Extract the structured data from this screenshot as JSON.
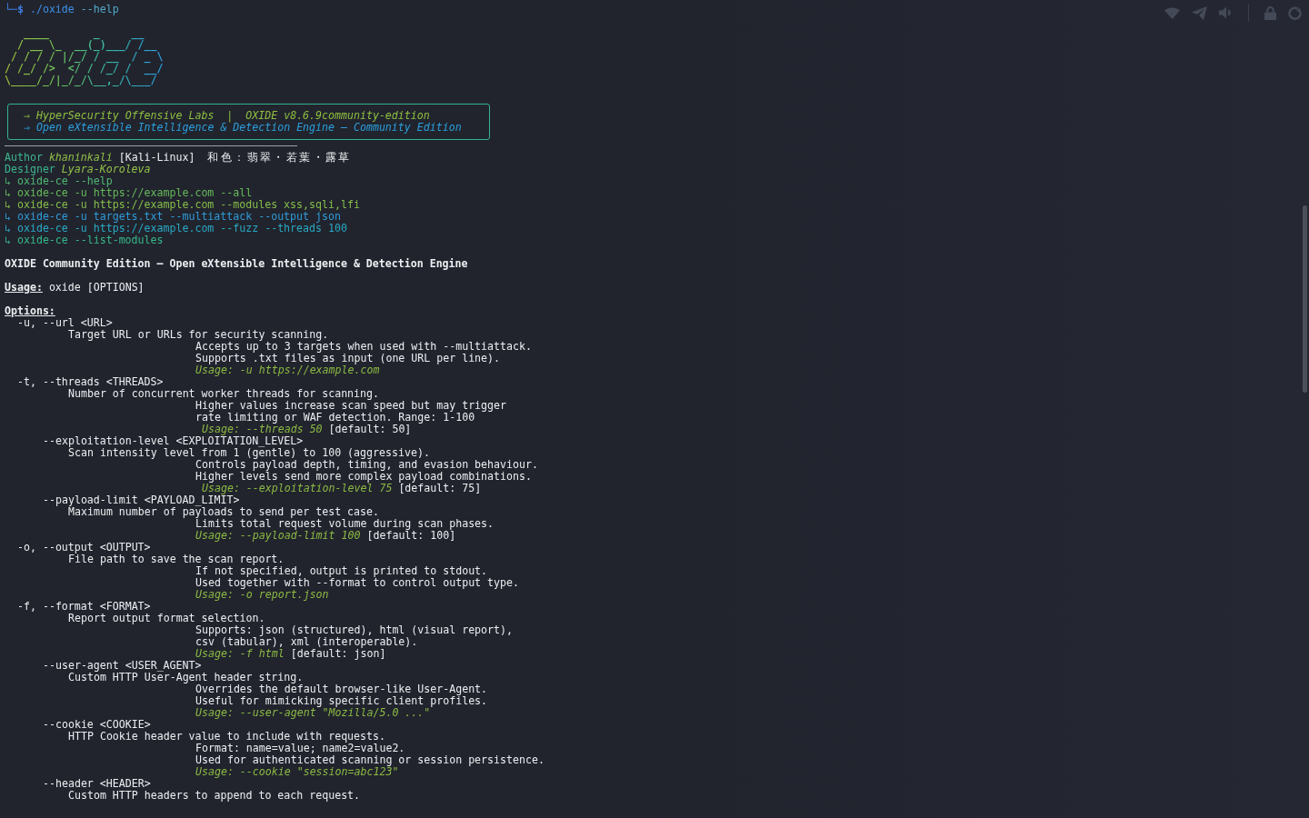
{
  "prompt": {
    "symbol": "└─$",
    "command": "./oxide",
    "args": "--help"
  },
  "logo": {
    "lines": [
      "   ____       _     __",
      "  / __ \\_  __(_)___/ /__",
      " / / / / |/_/ / __  / _ \\",
      "/ /_/ />  </ / /_/ /  __/",
      "\\____/_/|_/_/\\__,_/\\___/"
    ]
  },
  "banner": {
    "lines": [
      {
        "text": "⇒ HyperSecurity Offensive Labs  |  OXIDE v8.6.9community-edition",
        "color": "#8fbf3f"
      },
      {
        "text": "⇒ Open eXtensible Intelligence & Detection Engine — Community Edition",
        "color": "#2b9fdc"
      }
    ]
  },
  "credits": [
    {
      "label": "Author",
      "name": "khaninkali",
      "note": "[Kali-Linux]",
      "tagline": "和色：翡翠・若葉・露草"
    },
    {
      "label": "Designer",
      "name": "Lyara-Koroleva"
    }
  ],
  "examples": [
    {
      "text": "↳ oxide-ce --help",
      "color": "#4fb874"
    },
    {
      "text": "↳ oxide-ce -u https://example.com --all",
      "color": "#66b95a"
    },
    {
      "text": "↳ oxide-ce -u https://example.com --modules xss,sqli,lfi",
      "color": "#86bd4a"
    },
    {
      "text": "↳ oxide-ce -u targets.txt --multiattack --output json",
      "color": "#2f9bd8"
    },
    {
      "text": "↳ oxide-ce -u https://example.com --fuzz --threads 100",
      "color": "#2aa8c4"
    },
    {
      "text": "↳ oxide-ce --list-modules",
      "color": "#36b78a"
    }
  ],
  "title": "OXIDE Community Edition — Open eXtensible Intelligence & Detection Engine",
  "usage": {
    "label": "Usage:",
    "syntax": "oxide [OPTIONS]"
  },
  "options_heading": "Options:",
  "options": [
    {
      "kind": "short",
      "flag": "-u, --url <URL>",
      "summary": "Target URL or URLs for security scanning.",
      "details": [
        "Accepts up to 3 targets when used with --multiattack.",
        "Supports .txt files as input (one URL per line)."
      ],
      "example": "Usage: -u https://example.com"
    },
    {
      "kind": "short",
      "flag": "-t, --threads <THREADS>",
      "summary": "Number of concurrent worker threads for scanning.",
      "details": [
        "Higher values increase scan speed but may trigger",
        "rate limiting or WAF detection. Range: 1-100"
      ],
      "example": " Usage: --threads 50",
      "default": "[default: 50]"
    },
    {
      "kind": "long",
      "flag": "--exploitation-level <EXPLOITATION_LEVEL>",
      "summary": "Scan intensity level from 1 (gentle) to 100 (aggressive).",
      "details": [
        "Controls payload depth, timing, and evasion behaviour.",
        "Higher levels send more complex payload combinations."
      ],
      "example": " Usage: --exploitation-level 75",
      "default": "[default: 75]"
    },
    {
      "kind": "long",
      "flag": "--payload-limit <PAYLOAD_LIMIT>",
      "summary": "Maximum number of payloads to send per test case.",
      "details": [
        "Limits total request volume during scan phases."
      ],
      "example": "Usage: --payload-limit 100",
      "default": "[default: 100]"
    },
    {
      "kind": "short",
      "flag": "-o, --output <OUTPUT>",
      "summary": "File path to save the scan report.",
      "details": [
        "If not specified, output is printed to stdout.",
        "Used together with --format to control output type."
      ],
      "example": "Usage: -o report.json"
    },
    {
      "kind": "short",
      "flag": "-f, --format <FORMAT>",
      "summary": "Report output format selection.",
      "details": [
        "Supports: json (structured), html (visual report),",
        "csv (tabular), xml (interoperable)."
      ],
      "example": "Usage: -f html",
      "default": "[default: json]"
    },
    {
      "kind": "long",
      "flag": "--user-agent <USER_AGENT>",
      "summary": "Custom HTTP User-Agent header string.",
      "details": [
        "Overrides the default browser-like User-Agent.",
        "Useful for mimicking specific client profiles."
      ],
      "example": "Usage: --user-agent \"Mozilla/5.0 ...\""
    },
    {
      "kind": "long",
      "flag": "--cookie <COOKIE>",
      "summary": "HTTP Cookie header value to include with requests.",
      "details": [
        "Format: name=value; name2=value2.",
        "Used for authenticated scanning or session persistence."
      ],
      "example": "Usage: --cookie \"session=abc123\""
    },
    {
      "kind": "long",
      "flag": "--header <HEADER>",
      "summary": "Custom HTTP headers to append to each request."
    }
  ]
}
